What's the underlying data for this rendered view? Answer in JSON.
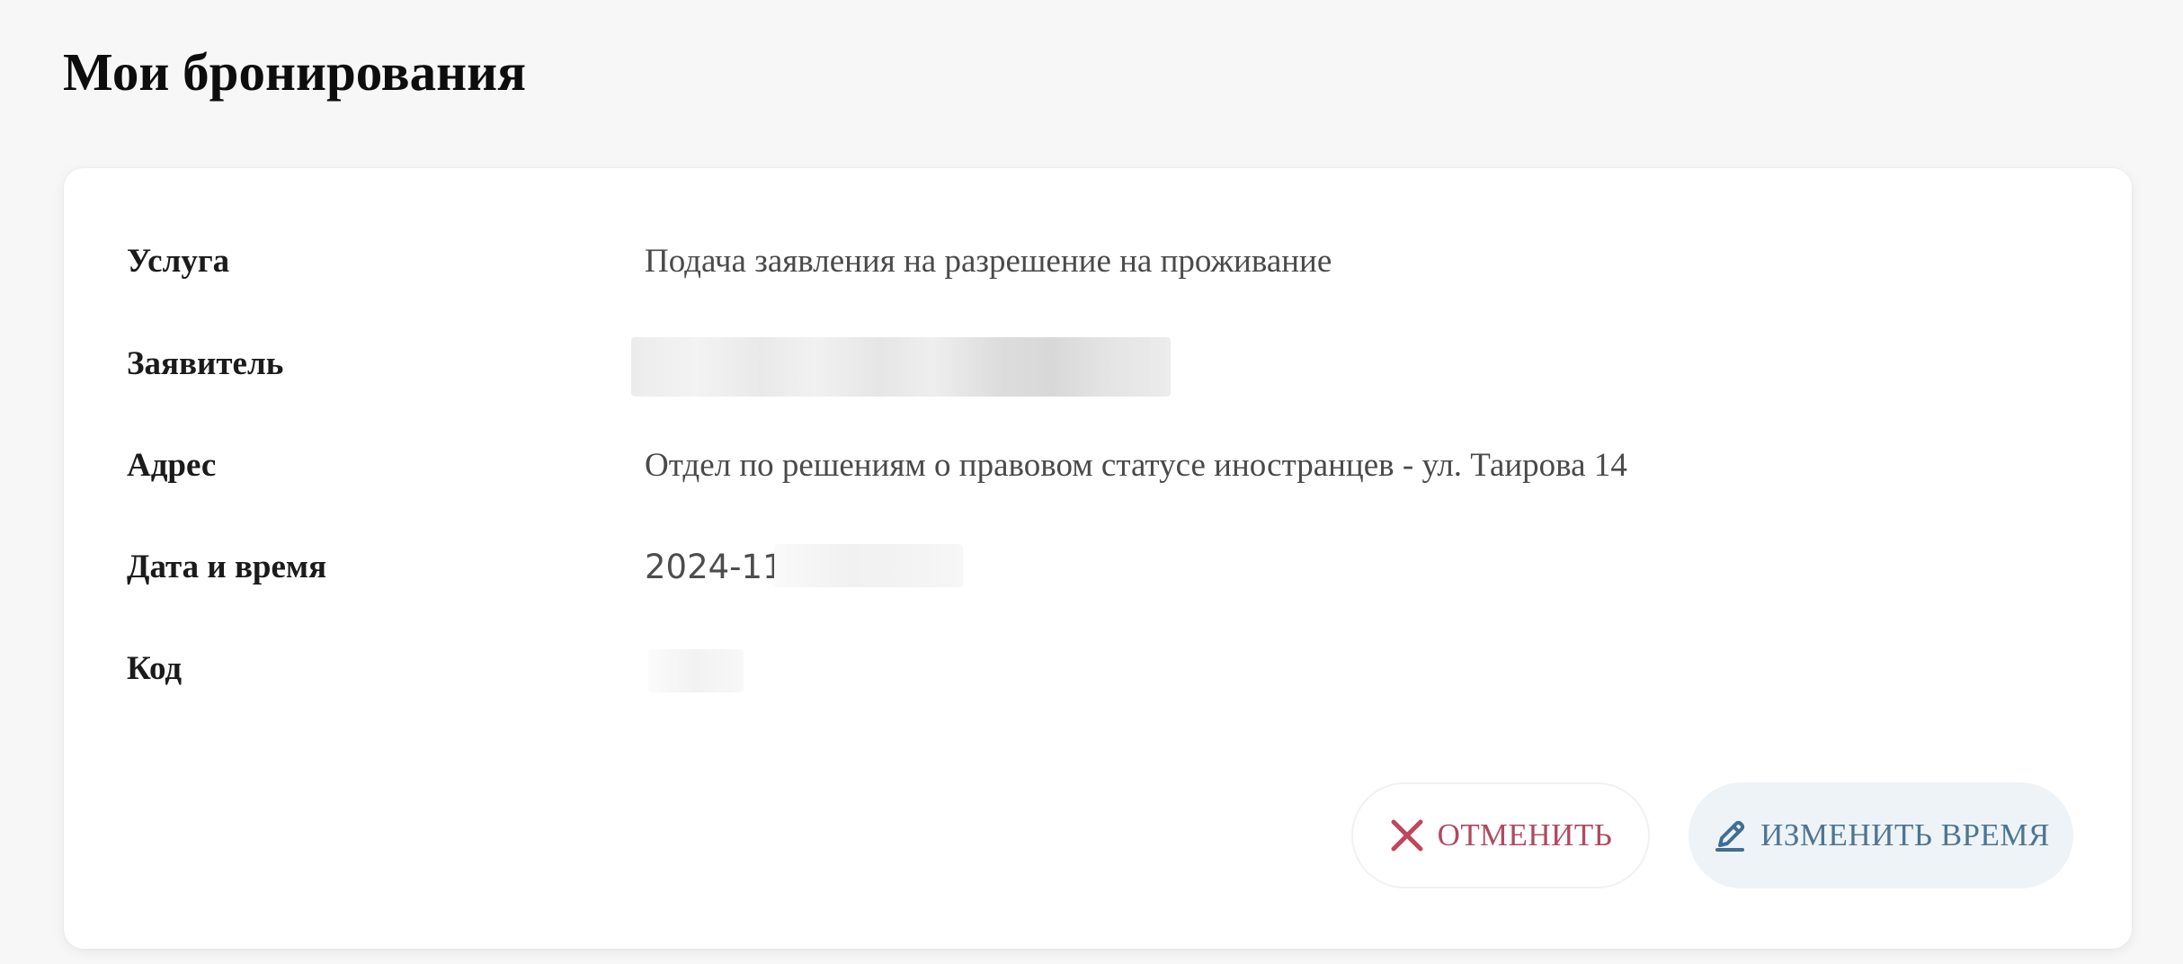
{
  "page": {
    "title": "Мои бронирования"
  },
  "booking": {
    "service_label": "Услуга",
    "service_value": "Подача заявления на разрешение на проживание",
    "applicant_label": "Заявитель",
    "applicant_value": "",
    "address_label": "Адрес",
    "address_value": "Отдел по решениям о правовом статусе иностранцев - ул. Таирова 14",
    "datetime_label": "Дата и время",
    "datetime_value": "2024-11",
    "code_label": "Код",
    "code_value": ""
  },
  "actions": {
    "cancel_label": "ОТМЕНИТЬ",
    "change_label": "ИЗМЕНИТЬ ВРЕМЯ"
  },
  "icons": {
    "cancel": "close-icon",
    "change": "pencil-icon"
  },
  "colors": {
    "cancel_accent": "#b04a61",
    "change_accent": "#4e7591",
    "change_background": "#eef3f7"
  }
}
